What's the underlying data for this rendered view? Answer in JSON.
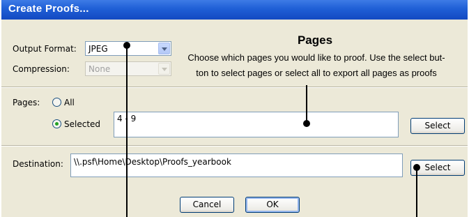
{
  "dialog": {
    "title": "Create Proofs..."
  },
  "format": {
    "output_format_label": "Output Format:",
    "output_format_value": "JPEG",
    "compression_label": "Compression:",
    "compression_value": "None"
  },
  "annotation": {
    "title": "Pages",
    "line1": "Choose which pages you would like to proof. Use the select but-",
    "line2": "ton to select pages or select all to export all pages as proofs"
  },
  "pages": {
    "label": "Pages:",
    "all_label": "All",
    "selected_label": "Selected",
    "selected_option": "Selected",
    "range_value": "4 - 9",
    "select_button": "Select"
  },
  "destination": {
    "label": "Destination:",
    "path": "\\\\.psf\\Home\\Desktop\\Proofs_yearbook",
    "select_button": "Select"
  },
  "actions": {
    "cancel": "Cancel",
    "ok": "OK"
  },
  "colors": {
    "title_bar": "#1f5fd6",
    "dialog_bg": "#ece9d8",
    "radio_selected": "#21a121"
  }
}
